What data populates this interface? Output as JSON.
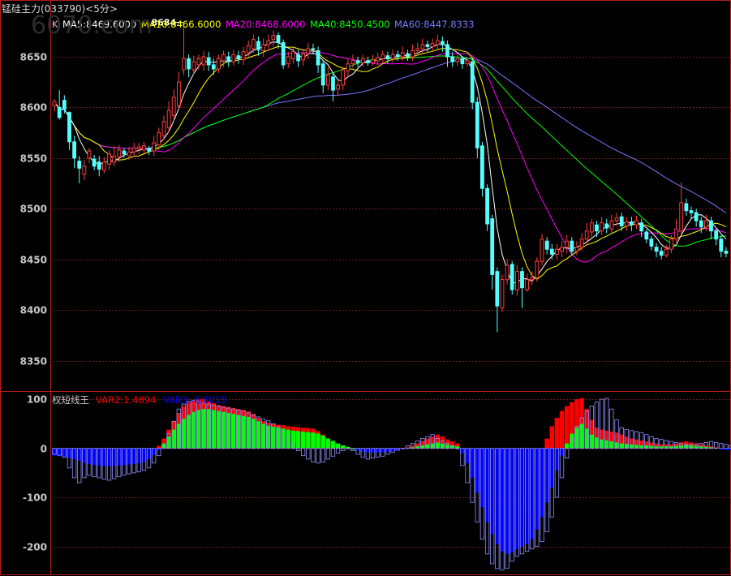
{
  "title": "锰硅主力(033790)<5分>",
  "watermark": "6070.com",
  "colors": {
    "background": "#000000",
    "frame": "#b41e1e",
    "grid": "#6e1a1a",
    "axis_text": "#c8c8c8",
    "candle_up": "#ff3c3c",
    "candle_down": "#54ffff",
    "ma5": "#ffffff",
    "ma10": "#ffff00",
    "ma20": "#ff00ff",
    "ma40": "#00ff00",
    "ma60": "#7878ff",
    "var_red": "#ff0000",
    "var_green": "#00ff00",
    "var_blue": "#0000ff",
    "var_outline": "#9090ff"
  },
  "chart_data": [
    {
      "type": "candlestick",
      "legend": [
        {
          "label": "K",
          "color": "#c8c8c8"
        },
        {
          "label": "MA5:8469.6000",
          "color": "#ffffff"
        },
        {
          "label": "MA10:8466.6000",
          "color": "#ffff00"
        },
        {
          "label": "MA20:8468.6000",
          "color": "#ff00ff"
        },
        {
          "label": "MA40:8450.4500",
          "color": "#00ff00"
        },
        {
          "label": "MA60:8447.8333",
          "color": "#7878ff"
        }
      ],
      "y_ticks": [
        8350,
        8400,
        8450,
        8500,
        8550,
        8600,
        8650
      ],
      "ylim": [
        8320,
        8690
      ],
      "annotation": {
        "label": "8684",
        "index": 26,
        "value": 8684
      },
      "candles": [
        [
          8602,
          8606,
          8608,
          8596
        ],
        [
          8600,
          8590,
          8617,
          8588
        ],
        [
          8607,
          8598,
          8612,
          8594
        ],
        [
          8595,
          8566,
          8596,
          8558
        ],
        [
          8566,
          8550,
          8572,
          8540
        ],
        [
          8547,
          8540,
          8552,
          8525
        ],
        [
          8534,
          8542,
          8548,
          8528
        ],
        [
          8550,
          8557,
          8560,
          8545
        ],
        [
          8549,
          8542,
          8553,
          8538
        ],
        [
          8546,
          8539,
          8552,
          8532
        ],
        [
          8538,
          8546,
          8551,
          8535
        ],
        [
          8544,
          8554,
          8558,
          8538
        ],
        [
          8546,
          8552,
          8562,
          8542
        ],
        [
          8551,
          8558,
          8563,
          8546
        ],
        [
          8557,
          8554,
          8559,
          8550
        ],
        [
          8552,
          8556,
          8561,
          8548
        ],
        [
          8556,
          8560,
          8565,
          8551
        ],
        [
          8559,
          8561,
          8565,
          8554
        ],
        [
          8558,
          8562,
          8566,
          8553
        ],
        [
          8559,
          8557,
          8562,
          8553
        ],
        [
          8557,
          8565,
          8572,
          8552
        ],
        [
          8563,
          8575,
          8580,
          8558
        ],
        [
          8572,
          8586,
          8592,
          8568
        ],
        [
          8580,
          8597,
          8606,
          8575
        ],
        [
          8592,
          8610,
          8618,
          8587
        ],
        [
          8602,
          8625,
          8635,
          8598
        ],
        [
          8637,
          8648,
          8684,
          8632
        ],
        [
          8648,
          8638,
          8652,
          8630
        ],
        [
          8637,
          8645,
          8651,
          8632
        ],
        [
          8642,
          8648,
          8652,
          8637
        ],
        [
          8642,
          8650,
          8656,
          8636
        ],
        [
          8649,
          8642,
          8655,
          8636
        ],
        [
          8642,
          8638,
          8648,
          8632
        ],
        [
          8638,
          8648,
          8652,
          8634
        ],
        [
          8646,
          8652,
          8656,
          8640
        ],
        [
          8650,
          8645,
          8655,
          8640
        ],
        [
          8645,
          8652,
          8657,
          8641
        ],
        [
          8651,
          8648,
          8656,
          8643
        ],
        [
          8647,
          8655,
          8660,
          8642
        ],
        [
          8654,
          8661,
          8666,
          8650
        ],
        [
          8658,
          8667,
          8672,
          8654
        ],
        [
          8665,
          8657,
          8670,
          8651
        ],
        [
          8656,
          8662,
          8668,
          8650
        ],
        [
          8662,
          8666,
          8672,
          8656
        ],
        [
          8667,
          8671,
          8676,
          8660
        ],
        [
          8671,
          8664,
          8674,
          8658
        ],
        [
          8664,
          8642,
          8667,
          8638
        ],
        [
          8643,
          8650,
          8655,
          8639
        ],
        [
          8648,
          8655,
          8659,
          8643
        ],
        [
          8652,
          8646,
          8657,
          8640
        ],
        [
          8647,
          8653,
          8658,
          8641
        ],
        [
          8653,
          8658,
          8664,
          8648
        ],
        [
          8658,
          8657,
          8663,
          8652
        ],
        [
          8656,
          8642,
          8660,
          8634
        ],
        [
          8643,
          8622,
          8646,
          8614
        ],
        [
          8622,
          8632,
          8640,
          8617
        ],
        [
          8630,
          8617,
          8634,
          8606
        ],
        [
          8618,
          8622,
          8627,
          8611
        ],
        [
          8622,
          8637,
          8640,
          8617
        ],
        [
          8636,
          8643,
          8648,
          8630
        ],
        [
          8643,
          8646,
          8652,
          8639
        ],
        [
          8646,
          8644,
          8650,
          8640
        ],
        [
          8644,
          8648,
          8652,
          8640
        ],
        [
          8646,
          8644,
          8650,
          8641
        ],
        [
          8644,
          8647,
          8652,
          8641
        ],
        [
          8646,
          8649,
          8654,
          8642
        ],
        [
          8648,
          8652,
          8656,
          8644
        ],
        [
          8651,
          8648,
          8655,
          8643
        ],
        [
          8648,
          8652,
          8657,
          8644
        ],
        [
          8652,
          8650,
          8656,
          8646
        ],
        [
          8650,
          8654,
          8660,
          8646
        ],
        [
          8653,
          8650,
          8657,
          8646
        ],
        [
          8650,
          8656,
          8662,
          8646
        ],
        [
          8656,
          8658,
          8664,
          8651
        ],
        [
          8658,
          8662,
          8668,
          8653
        ],
        [
          8662,
          8660,
          8666,
          8655
        ],
        [
          8660,
          8663,
          8668,
          8655
        ],
        [
          8662,
          8666,
          8672,
          8657
        ],
        [
          8665,
          8662,
          8670,
          8655
        ],
        [
          8662,
          8650,
          8666,
          8640
        ],
        [
          8650,
          8645,
          8655,
          8640
        ],
        [
          8645,
          8648,
          8652,
          8641
        ],
        [
          8648,
          8643,
          8651,
          8638
        ],
        [
          8643,
          8646,
          8649,
          8640
        ],
        [
          8645,
          8605,
          8648,
          8598
        ],
        [
          8605,
          8560,
          8610,
          8550
        ],
        [
          8562,
          8520,
          8566,
          8512
        ],
        [
          8520,
          8485,
          8524,
          8478
        ],
        [
          8490,
          8435,
          8494,
          8420
        ],
        [
          8438,
          8404,
          8442,
          8378
        ],
        [
          8402,
          8430,
          8435,
          8398
        ],
        [
          8430,
          8444,
          8450,
          8425
        ],
        [
          8445,
          8420,
          8448,
          8415
        ],
        [
          8420,
          8438,
          8444,
          8414
        ],
        [
          8438,
          8422,
          8442,
          8402
        ],
        [
          8420,
          8430,
          8436,
          8418
        ],
        [
          8430,
          8432,
          8438,
          8425
        ],
        [
          8432,
          8448,
          8452,
          8428
        ],
        [
          8448,
          8470,
          8475,
          8444
        ],
        [
          8468,
          8460,
          8472,
          8455
        ],
        [
          8460,
          8455,
          8465,
          8450
        ],
        [
          8455,
          8460,
          8465,
          8450
        ],
        [
          8458,
          8462,
          8468,
          8452
        ],
        [
          8462,
          8468,
          8474,
          8456
        ],
        [
          8468,
          8458,
          8472,
          8454
        ],
        [
          8458,
          8462,
          8468,
          8454
        ],
        [
          8462,
          8470,
          8476,
          8458
        ],
        [
          8470,
          8478,
          8486,
          8464
        ],
        [
          8477,
          8486,
          8490,
          8472
        ],
        [
          8484,
          8478,
          8488,
          8472
        ],
        [
          8478,
          8486,
          8492,
          8474
        ],
        [
          8485,
          8481,
          8490,
          8476
        ],
        [
          8480,
          8488,
          8494,
          8476
        ],
        [
          8488,
          8491,
          8496,
          8483
        ],
        [
          8492,
          8483,
          8496,
          8478
        ],
        [
          8483,
          8487,
          8492,
          8478
        ],
        [
          8487,
          8484,
          8492,
          8478
        ],
        [
          8484,
          8488,
          8493,
          8480
        ],
        [
          8486,
          8478,
          8490,
          8472
        ],
        [
          8477,
          8470,
          8480,
          8466
        ],
        [
          8470,
          8463,
          8473,
          8459
        ],
        [
          8462,
          8458,
          8466,
          8452
        ],
        [
          8458,
          8454,
          8462,
          8450
        ],
        [
          8454,
          8460,
          8464,
          8452
        ],
        [
          8460,
          8470,
          8474,
          8456
        ],
        [
          8470,
          8480,
          8490,
          8466
        ],
        [
          8478,
          8506,
          8526,
          8474
        ],
        [
          8505,
          8498,
          8510,
          8493
        ],
        [
          8498,
          8496,
          8502,
          8490
        ],
        [
          8496,
          8488,
          8500,
          8482
        ],
        [
          8488,
          8482,
          8492,
          8476
        ],
        [
          8482,
          8488,
          8494,
          8478
        ],
        [
          8488,
          8478,
          8492,
          8470
        ],
        [
          8478,
          8470,
          8480,
          8464
        ],
        [
          8470,
          8458,
          8474,
          8452
        ],
        [
          8458,
          8456,
          8462,
          8452
        ]
      ]
    },
    {
      "type": "bar",
      "indicator": "权短线王",
      "legend": [
        {
          "label": "VAR2:1.4894",
          "color": "#ff0000"
        },
        {
          "label": "VAR3:-6.8015",
          "color": "#0000ff"
        }
      ],
      "y_ticks": [
        100,
        0,
        -100,
        -200
      ],
      "ylim": [
        -255,
        115
      ],
      "var2": [
        -15,
        -16,
        -18,
        -20,
        -22,
        -25,
        -28,
        -30,
        -32,
        -33,
        -35,
        -36,
        -35,
        -34,
        -33,
        -32,
        -31,
        -30,
        -28,
        -22,
        -10,
        5,
        20,
        38,
        56,
        72,
        86,
        94,
        98,
        100,
        100,
        96,
        92,
        88,
        86,
        84,
        82,
        80,
        78,
        75,
        70,
        62,
        55,
        52,
        50,
        48,
        47,
        45,
        44,
        43,
        42,
        41,
        40,
        35,
        28,
        20,
        15,
        10,
        6,
        2,
        -2,
        -5,
        -7,
        -8,
        -8,
        -7,
        -6,
        -5,
        -4,
        -2,
        0,
        2,
        6,
        10,
        15,
        20,
        24,
        28,
        24,
        18,
        14,
        10,
        -5,
        -20,
        -50,
        -80,
        -105,
        -130,
        -160,
        -190,
        -205,
        -200,
        -188,
        -180,
        -160,
        -120,
        -80,
        -40,
        -10,
        20,
        45,
        62,
        76,
        86,
        94,
        100,
        102,
        80,
        58,
        42,
        38,
        36,
        34,
        32,
        28,
        24,
        20,
        18,
        16,
        14,
        12,
        10,
        8,
        8,
        8,
        10,
        12,
        14,
        12,
        10,
        8,
        6,
        4,
        2,
        -2,
        -4,
        -3,
        -4
      ],
      "var3": [
        -10,
        -12,
        -14,
        -18,
        -22,
        -26,
        -30,
        -32,
        -34,
        -35,
        -36,
        -37,
        -36,
        -35,
        -34,
        -33,
        -32,
        -30,
        -28,
        -22,
        -14,
        -4,
        10,
        24,
        38,
        50,
        60,
        68,
        74,
        78,
        80,
        80,
        78,
        76,
        74,
        72,
        70,
        68,
        66,
        64,
        60,
        55,
        50,
        46,
        44,
        42,
        40,
        38,
        36,
        35,
        34,
        33,
        32,
        30,
        26,
        20,
        15,
        10,
        6,
        3,
        0,
        -3,
        -6,
        -8,
        -9,
        -9,
        -8,
        -7,
        -6,
        -4,
        -2,
        0,
        2,
        4,
        6,
        8,
        10,
        12,
        10,
        8,
        6,
        4,
        -10,
        -30,
        -60,
        -90,
        -120,
        -150,
        -175,
        -195,
        -210,
        -215,
        -212,
        -205,
        -200,
        -195,
        -185,
        -165,
        -140,
        -110,
        -80,
        -45,
        -15,
        10,
        30,
        42,
        50,
        40,
        28,
        22,
        18,
        16,
        14,
        12,
        10,
        9,
        8,
        7,
        6,
        6,
        5,
        4,
        4,
        4,
        4,
        5,
        6,
        7,
        6,
        5,
        4,
        3,
        2,
        1,
        -1,
        -2,
        -3,
        -3
      ],
      "outline": [
        -12,
        -14,
        -18,
        -40,
        -60,
        -70,
        -60,
        -55,
        -58,
        -60,
        -63,
        -65,
        -62,
        -58,
        -55,
        -52,
        -50,
        -48,
        -45,
        -40,
        -30,
        -15,
        5,
        30,
        55,
        80,
        90,
        96,
        98,
        96,
        92,
        90,
        88,
        86,
        84,
        82,
        80,
        78,
        76,
        72,
        68,
        64,
        60,
        56,
        50,
        44,
        35,
        25,
        10,
        -5,
        -15,
        -22,
        -28,
        -30,
        -28,
        -22,
        -16,
        -10,
        -5,
        0,
        -5,
        -12,
        -18,
        -22,
        -20,
        -18,
        -16,
        -12,
        -8,
        -4,
        0,
        5,
        10,
        15,
        20,
        24,
        28,
        20,
        15,
        10,
        5,
        0,
        -35,
        -70,
        -110,
        -150,
        -185,
        -215,
        -235,
        -245,
        -248,
        -244,
        -230,
        -220,
        -215,
        -210,
        -205,
        -200,
        -190,
        -170,
        -140,
        -100,
        -60,
        -20,
        20,
        45,
        62,
        76,
        86,
        94,
        100,
        102,
        80,
        58,
        42,
        38,
        36,
        34,
        32,
        28,
        24,
        20,
        18,
        16,
        14,
        12,
        10,
        8,
        8,
        8,
        10,
        12,
        14,
        12,
        10,
        8,
        6,
        4,
        2,
        -5,
        -20,
        -18,
        -16
      ]
    }
  ]
}
